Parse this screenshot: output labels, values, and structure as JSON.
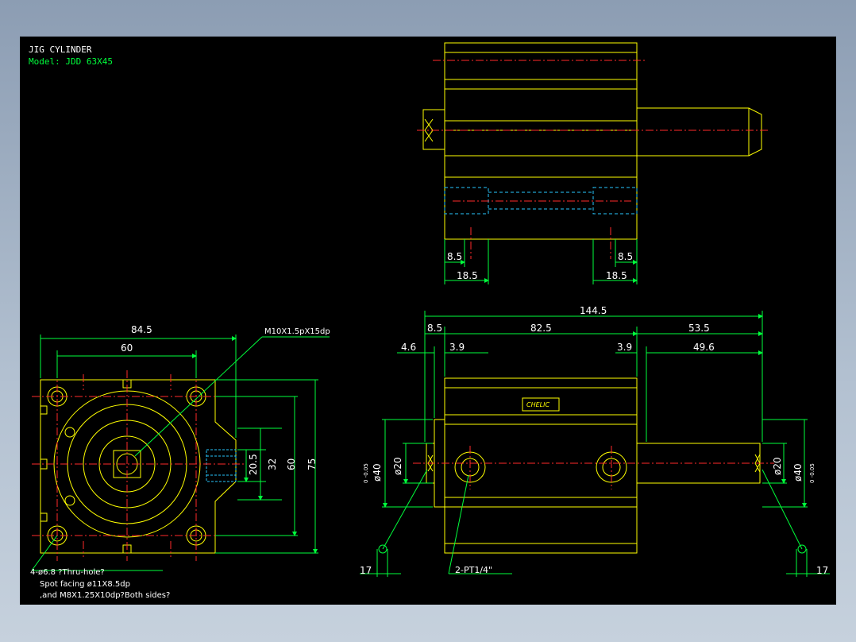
{
  "header": {
    "title": "JIG CYLINDER",
    "model": "Model: JDD 63X45"
  },
  "colors": {
    "background": "#000000",
    "outline": "#ffff00",
    "dimension": "#00ff3c",
    "center": "#ff2a2a",
    "hidden": "#27c9ff",
    "text": "#ffffff"
  },
  "top_view": {
    "dims": {
      "left_small": "8.5",
      "left_big": "18.5",
      "right_small": "8.5",
      "right_big": "18.5"
    }
  },
  "front_view": {
    "dims": {
      "width": "84.5",
      "bolt_spacing": "60",
      "d1": "20.5",
      "d2": "32",
      "d3": "60",
      "height": "75"
    },
    "callout": "M10X1.5pX15dp",
    "notes": [
      "4-ø6.8 ?Thru-hole?",
      "Spot facing ø11X8.5dp",
      ",and M8X1.25X10dp?Both sides?"
    ]
  },
  "side_view": {
    "dims": {
      "overall": "144.5",
      "a": "8.5",
      "b": "82.5",
      "c": "53.5",
      "d": "4.6",
      "e": "3.9",
      "f": "3.9",
      "g": "49.6",
      "dia_left": "ø40",
      "dia_left_tol": "0\n-0.05",
      "dia_left_small": "ø20",
      "dia_right": "ø40",
      "dia_right_tol": "0\n-0.05",
      "dia_right_small": "ø20",
      "left_port": "17",
      "right_port": "17"
    },
    "port_note": "2-PT1/4\"",
    "logo": "CHELIC"
  }
}
